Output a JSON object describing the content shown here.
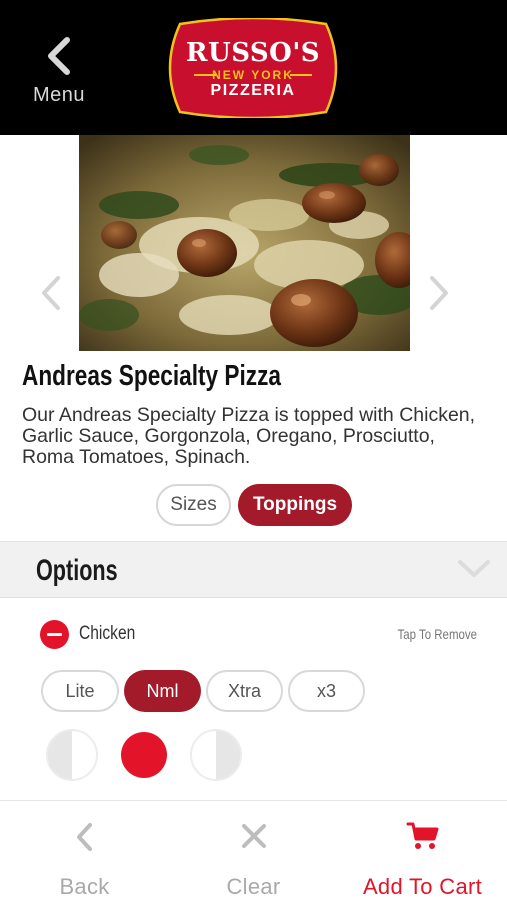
{
  "header": {
    "menu_label": "Menu",
    "logo": {
      "line1": "RUSSO'S",
      "line2": "NEW YORK",
      "line3": "PIZZERIA"
    }
  },
  "product": {
    "title": "Andreas Specialty Pizza",
    "description": "Our Andreas Specialty Pizza is topped with Chicken, Garlic Sauce, Gorgonzola, Oregano, Prosciutto, Roma Tomatoes, Spinach."
  },
  "tabs": [
    {
      "label": "Sizes",
      "selected": false
    },
    {
      "label": "Toppings",
      "selected": true
    }
  ],
  "options": {
    "title": "Options",
    "topping": {
      "name": "Chicken",
      "hint": "Tap To Remove",
      "amounts": [
        {
          "label": "Lite",
          "selected": false
        },
        {
          "label": "Nml",
          "selected": true
        },
        {
          "label": "Xtra",
          "selected": false
        },
        {
          "label": "x3",
          "selected": false
        }
      ],
      "portions": [
        {
          "name": "left-half",
          "selected": false
        },
        {
          "name": "whole",
          "selected": true
        },
        {
          "name": "right-half",
          "selected": false
        }
      ]
    }
  },
  "toolbar": {
    "back_label": "Back",
    "clear_label": "Clear",
    "cart_label": "Add To Cart"
  },
  "colors": {
    "brand_red": "#a31a2b",
    "accent_red": "#e3132a",
    "header_bg": "#000000",
    "logo_yellow": "#f2c21b",
    "muted_gray": "#a9a9a9"
  },
  "icons": [
    "chevron-left-icon",
    "chevron-right-icon",
    "chevron-down-icon",
    "remove-icon",
    "close-icon",
    "cart-icon"
  ]
}
